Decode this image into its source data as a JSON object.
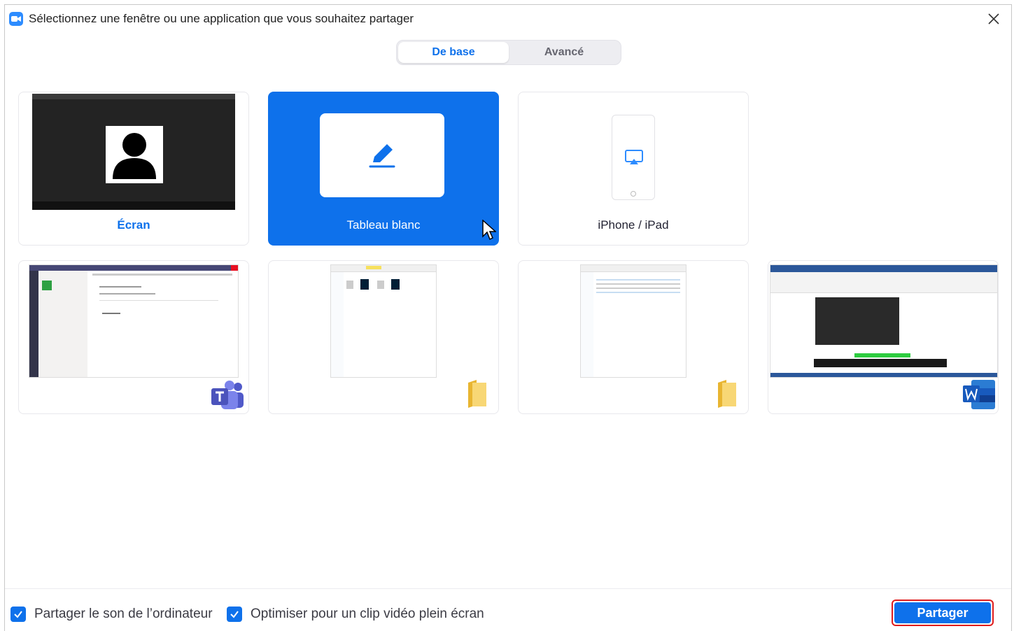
{
  "window": {
    "title": "Sélectionnez une fenêtre ou une application que vous souhaitez partager",
    "app_icon": "zoom-camera-icon",
    "close_icon": "close-icon"
  },
  "tabs": [
    {
      "label": "De base",
      "selected": true
    },
    {
      "label": "Avancé",
      "selected": false
    }
  ],
  "share_options": [
    {
      "label": "Écran",
      "icon": "screen-preview",
      "selected": false
    },
    {
      "label": "Tableau blanc",
      "icon": "pencil-icon",
      "selected": true
    },
    {
      "label": "iPhone / iPad",
      "icon": "airplay-icon",
      "selected": false
    }
  ],
  "windows": [
    {
      "app": "Microsoft Teams",
      "badge_icon": "teams-icon"
    },
    {
      "app": "Explorateur de fichiers",
      "badge_icon": "folder-icon"
    },
    {
      "app": "Explorateur de fichiers",
      "badge_icon": "folder-icon"
    },
    {
      "app": "Microsoft Word",
      "badge_icon": "word-icon"
    }
  ],
  "footer": {
    "share_sound_label": "Partager le son de l’ordinateur",
    "share_sound_checked": true,
    "optimize_video_label": "Optimiser pour un clip vidéo plein écran",
    "optimize_video_checked": true,
    "share_button_label": "Partager"
  },
  "colors": {
    "accent": "#0e71eb",
    "highlight_border": "#e01c1c"
  }
}
